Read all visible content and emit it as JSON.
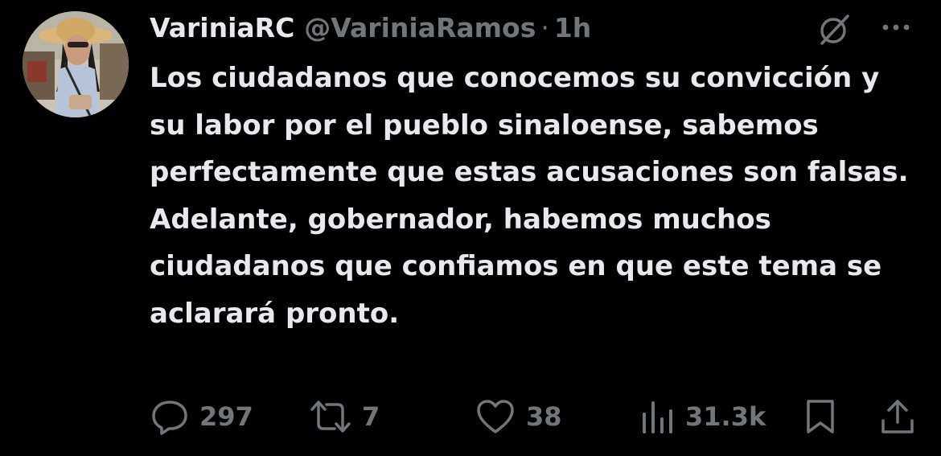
{
  "tweet": {
    "display_name": "VariniaRC",
    "handle": "@VariniaRamos",
    "separator": "·",
    "time": "1h",
    "text": "Los ciudadanos que conocemos su convicción y su labor por el pueblo sinaloense, sabemos perfectamente que estas acusaciones son falsas. Adelante, gobernador, habemos muchos ciudadanos que confiamos en que este tema se aclarará pronto."
  },
  "actions": {
    "replies": "297",
    "reposts": "7",
    "likes": "38",
    "views": "31.3k"
  },
  "icons": {
    "header": [
      "grok-icon",
      "more-options-icon"
    ],
    "actions": [
      "reply-icon",
      "repost-icon",
      "like-icon",
      "views-icon",
      "bookmark-icon",
      "share-icon"
    ]
  },
  "colors": {
    "background": "#000000",
    "text_primary": "#e7e9ea",
    "text_secondary": "#71767b"
  }
}
